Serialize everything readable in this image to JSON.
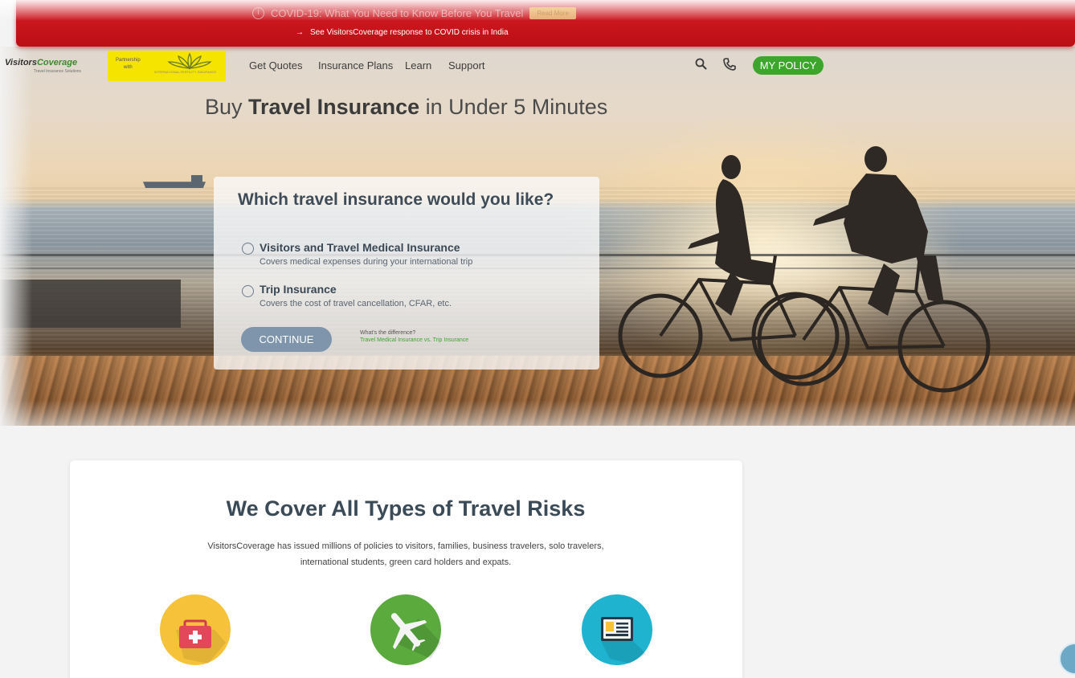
{
  "app": {
    "brand_pre": "Visitors",
    "brand_post": "Coverage",
    "brand_sub": "Travel Insurance Solutions"
  },
  "covid_banner": {
    "headline": "COVID-19: What You Need to Know Before You Travel",
    "read_more_label": "Read More",
    "arrow": "→",
    "india_link": "See VisitorsCoverage response to COVID crisis in India"
  },
  "partner": {
    "text_line1": "Partnership",
    "text_line2": "with",
    "caption": "INTERNATIONAL FERTILITY INSURANCE"
  },
  "nav": {
    "items": [
      {
        "label": "Get Quotes"
      },
      {
        "label": "Insurance Plans"
      },
      {
        "label": "Learn"
      },
      {
        "label": "Support"
      }
    ],
    "search_icon": "search-icon",
    "phone_icon": "phone-icon",
    "my_policy_label": "MY POLICY"
  },
  "hero": {
    "title_pre": "Buy ",
    "title_bold": "Travel Insurance",
    "title_post": " in Under 5 Minutes"
  },
  "selector": {
    "question": "Which travel insurance would you like?",
    "options": [
      {
        "title": "Visitors and Travel Medical Insurance",
        "desc": "Covers medical expenses during your international trip",
        "selected": false
      },
      {
        "title": "Trip Insurance",
        "desc": "Covers the cost of travel cancellation, CFAR, etc.",
        "selected": false
      }
    ],
    "continue_label": "CONTINUE",
    "difference_question": "What's the difference?",
    "difference_link": "Travel Medical Insurance vs. Trip Insurance"
  },
  "risks": {
    "title": "We Cover All Types of Travel Risks",
    "description": "VisitorsCoverage has issued millions of policies to visitors, families, business travelers, solo travelers, international students, green card holders and expats.",
    "icons": [
      {
        "name": "first-aid-kit-icon",
        "color": "#f5c23a"
      },
      {
        "name": "airplane-icon",
        "color": "#5aaa3e"
      },
      {
        "name": "id-card-icon",
        "color": "#1fb3d0"
      }
    ]
  },
  "colors": {
    "banner_red": "#c8141b",
    "accent_green": "#3ba52c",
    "continue_blue": "#7e95ab",
    "partner_yellow": "#f5e400"
  }
}
